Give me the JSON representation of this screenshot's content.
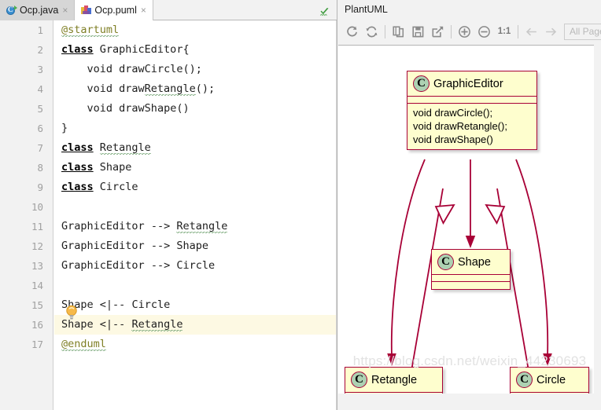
{
  "editor": {
    "tabs": [
      {
        "label": "Ocp.java",
        "icon": "java-file-icon",
        "active": false,
        "close_glyph": "×"
      },
      {
        "label": "Ocp.puml",
        "icon": "puml-file-icon",
        "active": true,
        "close_glyph": "×"
      }
    ],
    "current_line": 16,
    "inspection_status_icon": "green-check-icon",
    "intention_icon": "lightbulb-icon",
    "lines": [
      {
        "n": 1,
        "text": "@startuml"
      },
      {
        "n": 2,
        "text": "class GraphicEditor{"
      },
      {
        "n": 3,
        "text": "    void drawCircle();"
      },
      {
        "n": 4,
        "text": "    void drawRetangle();"
      },
      {
        "n": 5,
        "text": "    void drawShape()"
      },
      {
        "n": 6,
        "text": "}"
      },
      {
        "n": 7,
        "text": "class Retangle"
      },
      {
        "n": 8,
        "text": "class Shape"
      },
      {
        "n": 9,
        "text": "class Circle"
      },
      {
        "n": 10,
        "text": ""
      },
      {
        "n": 11,
        "text": "GraphicEditor --> Retangle"
      },
      {
        "n": 12,
        "text": "GraphicEditor --> Shape"
      },
      {
        "n": 13,
        "text": "GraphicEditor --> Circle"
      },
      {
        "n": 14,
        "text": ""
      },
      {
        "n": 15,
        "text": "Shape <|-- Circle"
      },
      {
        "n": 16,
        "text": "Shape <|-- Retangle"
      },
      {
        "n": 17,
        "text": "@enduml"
      }
    ]
  },
  "uml_panel": {
    "title": "PlantUML",
    "toolbar": {
      "buttons": [
        {
          "name": "reload-icon",
          "tooltip": "Reload"
        },
        {
          "name": "refresh-icon",
          "tooltip": "Refresh"
        },
        {
          "name": "copy-icon",
          "tooltip": "Copy Diagram to Clipboard"
        },
        {
          "name": "save-icon",
          "tooltip": "Save Diagram"
        },
        {
          "name": "open-external-icon",
          "tooltip": "Open in External Editor"
        },
        {
          "name": "zoom-in-icon",
          "tooltip": "Zoom In"
        },
        {
          "name": "zoom-out-icon",
          "tooltip": "Zoom Out"
        },
        {
          "name": "zoom-actual-label",
          "tooltip": "Actual Size"
        },
        {
          "name": "prev-page-icon",
          "tooltip": "Previous Page"
        },
        {
          "name": "next-page-icon",
          "tooltip": "Next Page"
        }
      ],
      "zoom_actual_label": "1:1",
      "page_field_value": "All Page"
    },
    "watermark": "https://blog.csdn.net/weixin_44230693",
    "colors": {
      "box_fill": "#FEFECE",
      "box_border": "#A80036",
      "badge_fill": "#ADD1B2",
      "arrow": "#A80036"
    },
    "diagram": {
      "type": "class-diagram",
      "classes": [
        {
          "id": "GraphicEditor",
          "name": "GraphicEditor",
          "badge": "C",
          "attributes": [],
          "methods": [
            "void drawCircle();",
            "void drawRetangle();",
            "void drawShape()"
          ]
        },
        {
          "id": "Shape",
          "name": "Shape",
          "badge": "C",
          "attributes": [],
          "methods": []
        },
        {
          "id": "Retangle",
          "name": "Retangle",
          "badge": "C",
          "attributes": [],
          "methods": []
        },
        {
          "id": "Circle",
          "name": "Circle",
          "badge": "C",
          "attributes": [],
          "methods": []
        }
      ],
      "relations": [
        {
          "from": "GraphicEditor",
          "to": "Retangle",
          "kind": "association",
          "arrow": "solid-filled"
        },
        {
          "from": "GraphicEditor",
          "to": "Shape",
          "kind": "association",
          "arrow": "solid-filled"
        },
        {
          "from": "GraphicEditor",
          "to": "Circle",
          "kind": "association",
          "arrow": "solid-filled"
        },
        {
          "from": "Circle",
          "to": "Shape",
          "kind": "inheritance",
          "arrow": "hollow-triangle"
        },
        {
          "from": "Retangle",
          "to": "Shape",
          "kind": "inheritance",
          "arrow": "hollow-triangle"
        }
      ]
    }
  }
}
